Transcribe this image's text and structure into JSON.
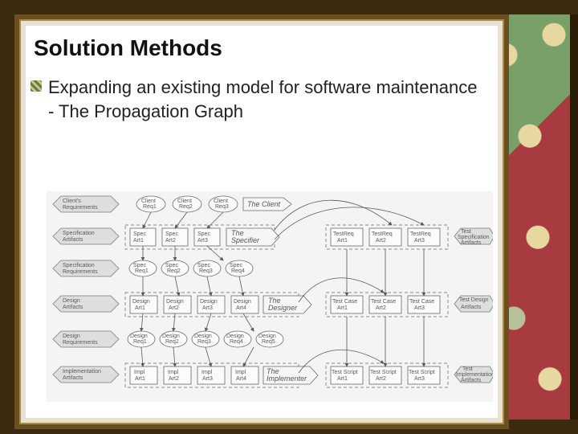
{
  "slide": {
    "title": "Solution Methods",
    "bullet": "Expanding an existing model for software maintenance - The Propagation Graph"
  },
  "diagram": {
    "left_row_labels": [
      "Client's Requirements",
      "Specification Artifacts",
      "Specification Requirements",
      "Design Artifacts",
      "Design Requirements",
      "Implementation Artifacts"
    ],
    "row_tags": [
      "The Client",
      "The Specifier",
      "The Designer",
      "The Implementer"
    ],
    "spec_row": [
      "Spec Art1",
      "Spec Art2",
      "Spec Art3"
    ],
    "design_row": [
      "Design Art1",
      "Design Art2",
      "Design Art3",
      "Design Art4"
    ],
    "impl_row": [
      "Impl Art1",
      "Impl Art2",
      "Impl Art3",
      "Impl Art4"
    ],
    "client_req": [
      "Client Req1",
      "Client Req2",
      "Client Req3"
    ],
    "spec_req": [
      "Spec Req1",
      "Spec Req2",
      "Spec Req3",
      "Spec Req4"
    ],
    "design_req": [
      "Design Req1",
      "Design Req2",
      "Design Req3",
      "Design Req4",
      "Design Req5"
    ],
    "right_groups": [
      {
        "label": "Test Specification Artifacts",
        "items": [
          "TestReq Art1",
          "TestReq Art2",
          "TestReq Art3"
        ]
      },
      {
        "label": "Test Design Artifacts",
        "items": [
          "Test Case Art1",
          "Test Case Art2",
          "Test Case Art3"
        ]
      },
      {
        "label": "Test Implementation Artifacts",
        "items": [
          "Test Script Art1",
          "Test Script Art2",
          "Test Script Art3"
        ]
      }
    ]
  }
}
